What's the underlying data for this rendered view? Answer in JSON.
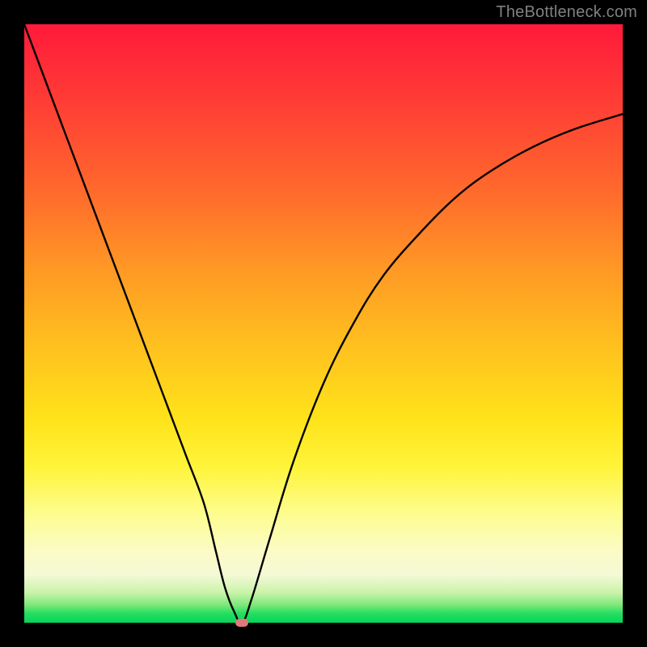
{
  "watermark": "TheBottleneck.com",
  "colors": {
    "frame": "#000000",
    "curve": "#000000",
    "marker": "#e07a7a",
    "gradient_top": "#ff1a3b",
    "gradient_bottom": "#05d55a"
  },
  "chart_data": {
    "type": "line",
    "title": "",
    "xlabel": "",
    "ylabel": "",
    "xlim": [
      0,
      100
    ],
    "ylim": [
      0,
      100
    ],
    "annotations": [
      {
        "text": "TheBottleneck.com",
        "position": "top-right"
      }
    ],
    "series": [
      {
        "name": "bottleneck-curve",
        "x": [
          0,
          3,
          6,
          9,
          12,
          15,
          18,
          21,
          24,
          27,
          30,
          32,
          33.5,
          35,
          36.4,
          38,
          41,
          45,
          50,
          55,
          60,
          66,
          72,
          78,
          85,
          92,
          100
        ],
        "values": [
          100,
          92,
          84,
          76,
          68,
          60,
          52,
          44,
          36,
          28,
          20,
          12,
          6,
          2,
          0,
          4,
          14,
          27,
          40,
          50,
          58,
          65,
          71,
          75.5,
          79.5,
          82.5,
          85
        ]
      }
    ],
    "marker": {
      "x": 36.4,
      "y": 0
    }
  }
}
